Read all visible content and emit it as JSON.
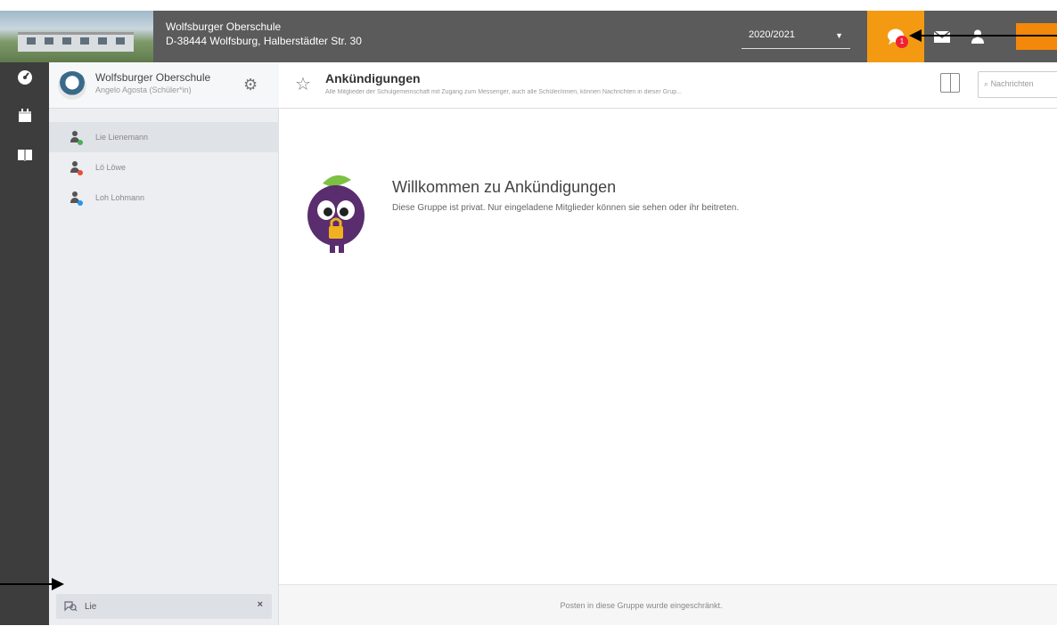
{
  "header": {
    "school_name": "Wolfsburger Oberschule",
    "school_address": "D-38444 Wolfsburg, Halberstädter Str. 30",
    "year": "2020/2021",
    "chat_badge": "1"
  },
  "sidebar": {
    "org_title": "Wolfsburger Oberschule",
    "org_sub": "Angelo Agosta (Schüler*in)",
    "contacts": [
      {
        "name": "Lie Lienemann",
        "status_color": "#4caf50"
      },
      {
        "name": "Lö Löwe",
        "status_color": "#e74c3c"
      },
      {
        "name": "Loh Lohmann",
        "status_color": "#2196f3"
      }
    ],
    "search_value": "Lie"
  },
  "channel": {
    "title": "Ankündigungen",
    "description": "Alle Mitglieder der Schulgemeinschaft mit Zugang zum Messenger, auch alle Schüler/innen, können Nachrichten in dieser Grup...",
    "search_placeholder": "Nachrichten"
  },
  "welcome": {
    "title": "Willkommen zu Ankündigungen",
    "subtitle": "Diese Gruppe ist privat. Nur eingeladene Mitglieder können sie sehen oder ihr beitreten."
  },
  "footer": {
    "text": "Posten in diese Gruppe wurde eingeschränkt."
  }
}
